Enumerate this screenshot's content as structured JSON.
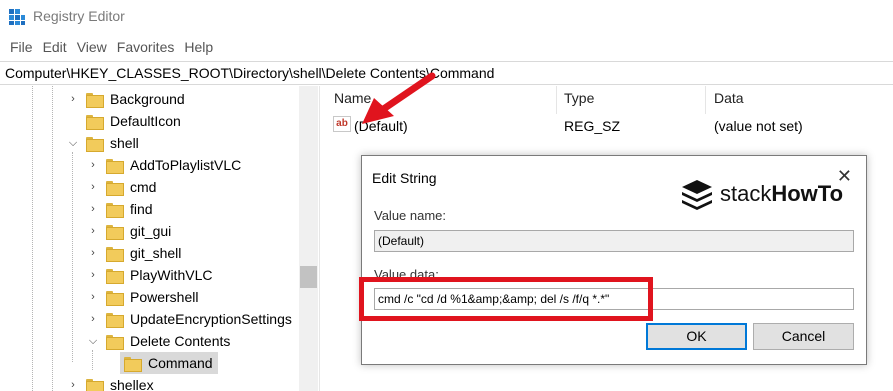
{
  "window": {
    "title": "Registry Editor"
  },
  "menu": [
    "File",
    "Edit",
    "View",
    "Favorites",
    "Help"
  ],
  "address": "Computer\\HKEY_CLASSES_ROOT\\Directory\\shell\\Delete Contents\\Command",
  "tree": {
    "items": [
      {
        "label": "Background",
        "icon": "folder-icon",
        "chevron": "chevron-right-icon"
      },
      {
        "label": "DefaultIcon",
        "icon": "folder-icon",
        "chevron": ""
      },
      {
        "label": "shell",
        "icon": "folder-icon",
        "chevron": "chevron-down-icon"
      },
      {
        "label": "AddToPlaylistVLC",
        "icon": "folder-icon",
        "chevron": "chevron-right-icon"
      },
      {
        "label": "cmd",
        "icon": "folder-icon",
        "chevron": "chevron-right-icon"
      },
      {
        "label": "find",
        "icon": "folder-icon",
        "chevron": "chevron-right-icon"
      },
      {
        "label": "git_gui",
        "icon": "folder-icon",
        "chevron": "chevron-right-icon"
      },
      {
        "label": "git_shell",
        "icon": "folder-icon",
        "chevron": "chevron-right-icon"
      },
      {
        "label": "PlayWithVLC",
        "icon": "folder-icon",
        "chevron": "chevron-right-icon"
      },
      {
        "label": "Powershell",
        "icon": "folder-icon",
        "chevron": "chevron-right-icon"
      },
      {
        "label": "UpdateEncryptionSettings",
        "icon": "folder-icon",
        "chevron": "chevron-right-icon"
      },
      {
        "label": "Delete Contents",
        "icon": "folder-icon",
        "chevron": "chevron-down-icon"
      },
      {
        "label": "Command",
        "icon": "folder-icon",
        "chevron": "",
        "selected": true
      },
      {
        "label": "shellex",
        "icon": "folder-icon",
        "chevron": "chevron-right-icon"
      }
    ]
  },
  "list": {
    "columns": [
      "Name",
      "Type",
      "Data"
    ],
    "rows": [
      {
        "name": "(Default)",
        "type": "REG_SZ",
        "data": "(value not set)",
        "icon": "string-value-icon"
      }
    ]
  },
  "dialog": {
    "title": "Edit String",
    "value_name_label": "Value name:",
    "value_name": "(Default)",
    "value_data_label": "Value data:",
    "value_data": "cmd /c \"cd /d %1&amp;&amp; del /s /f/q *.*\"",
    "ok_label": "OK",
    "cancel_label": "Cancel",
    "close_icon": "close-icon"
  },
  "watermark": {
    "brand_light": "stack",
    "brand_bold": "HowTo"
  },
  "annotation": {
    "arrow_color": "#e0141e",
    "box_color": "#e0141e"
  }
}
